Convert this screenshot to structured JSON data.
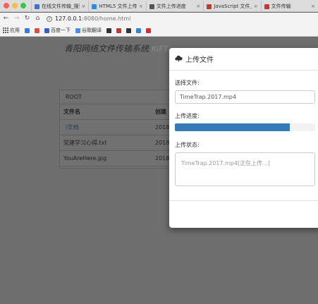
{
  "browser": {
    "tabs": [
      {
        "title": "在线文件传输_搜索",
        "icon_color": "#3f6fd8",
        "active": false
      },
      {
        "title": "HTML5 文件上传",
        "icon_color": "#2f8ae0",
        "active": false
      },
      {
        "title": "文件上传进度",
        "icon_color": "#555555",
        "active": false
      },
      {
        "title": "JavaScript 文件上传 异步",
        "icon_color": "#c0392b",
        "active": false
      },
      {
        "title": "文件传输",
        "icon_color": "#d03030",
        "active": false
      }
    ],
    "url_host": "127.0.0.1",
    "url_path": ":8080/home.html",
    "bookmarks": [
      {
        "label": "应用",
        "icon": "apps-icon",
        "color": "#666666"
      },
      {
        "label": "",
        "icon": "bookmark-icon",
        "color": "#2b7de9"
      },
      {
        "label": "",
        "icon": "bookmark-icon",
        "color": "#e24b3b"
      },
      {
        "label": "百度一下",
        "icon": "paw-icon",
        "color": "#2f5fd0"
      },
      {
        "label": "谷歌翻译",
        "icon": "bookmark-icon",
        "color": "#4a8cf0"
      },
      {
        "label": "",
        "icon": "bookmark-icon",
        "color": "#333333"
      },
      {
        "label": "",
        "icon": "bookmark-icon",
        "color": "#c0392b"
      },
      {
        "label": "",
        "icon": "bookmark-icon",
        "color": "#333333"
      },
      {
        "label": "",
        "icon": "bookmark-icon",
        "color": "#1e88e5"
      },
      {
        "label": "",
        "icon": "bookmark-icon",
        "color": "#d32f2f"
      }
    ]
  },
  "page": {
    "title": "青阳网络文件传输系统",
    "brand": "KIFT"
  },
  "table": {
    "root_label": "ROOT",
    "col_name": "文件名",
    "col_date": "创建",
    "rows": [
      {
        "name": "/文档",
        "date": "2018",
        "is_folder": true
      },
      {
        "name": "党建学习心得.txt",
        "date": "2018",
        "is_folder": false
      },
      {
        "name": "YouAreHere.jpg",
        "date": "2018",
        "is_folder": false
      }
    ]
  },
  "modal": {
    "title": "上传文件",
    "choose_label": "选择文件:",
    "file_value": "TimeTrap.2017.mp4",
    "progress_label": "上传进度:",
    "progress_fraction": 0.82,
    "status_label": "上传状态:",
    "status_text": "TimeTrap.2017.mp4[正在上传...]",
    "accent": "#337ab7"
  }
}
